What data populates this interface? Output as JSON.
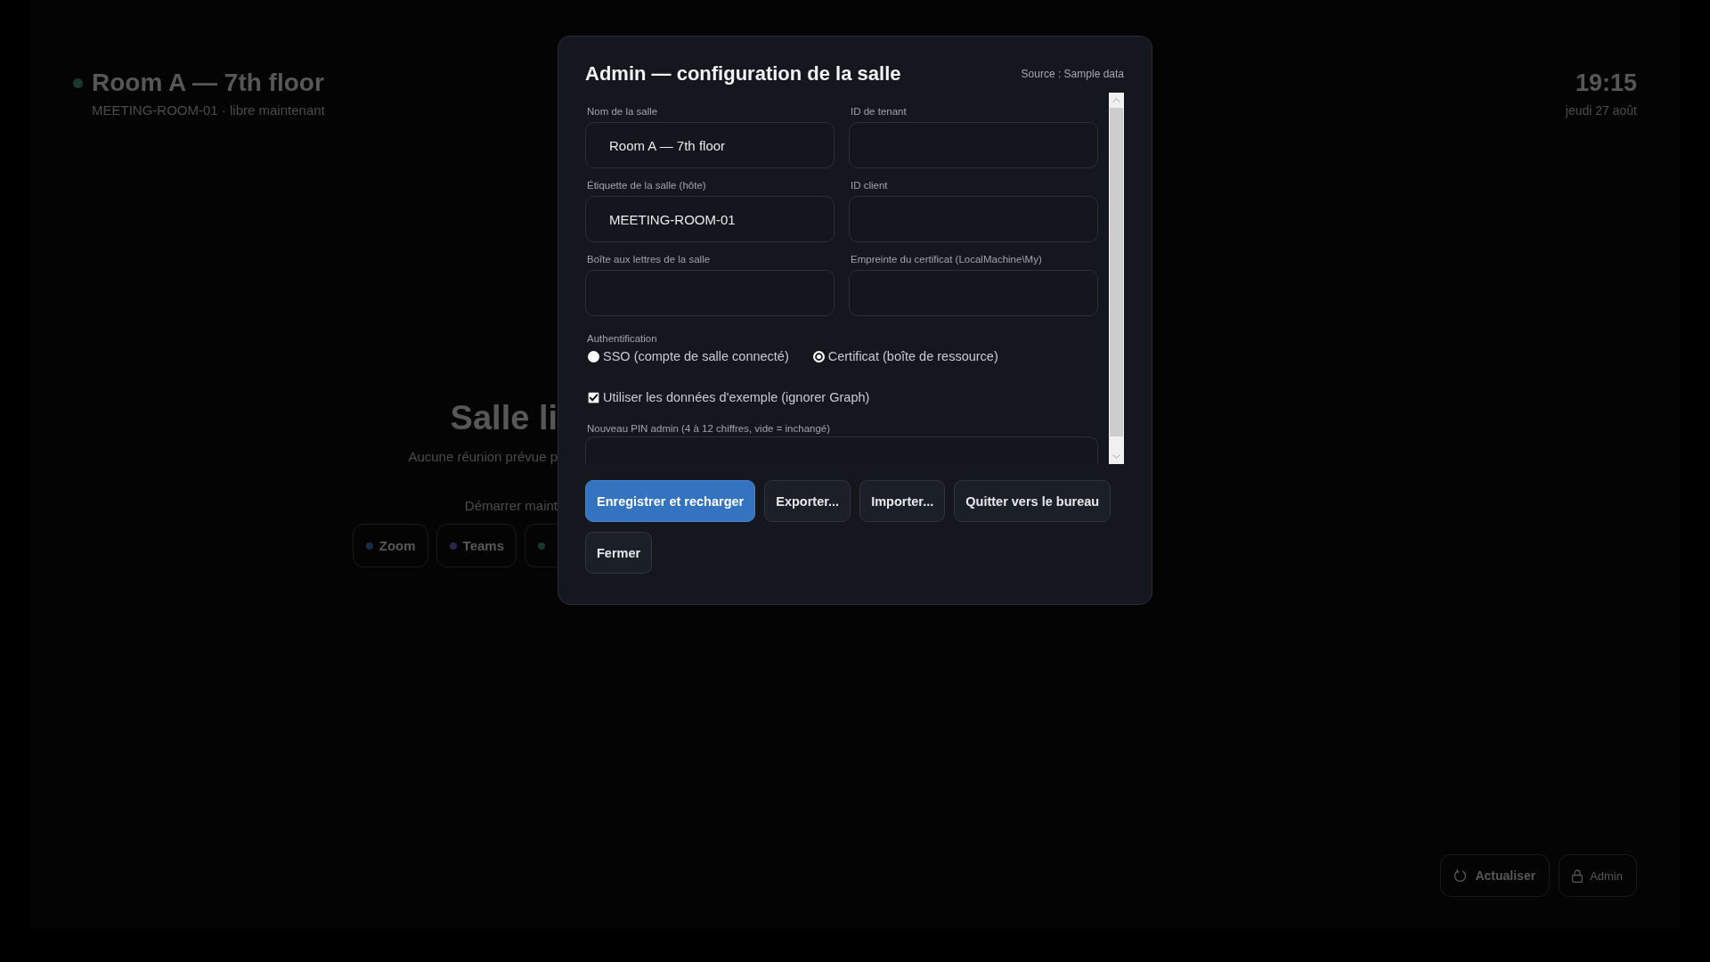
{
  "background": {
    "header": {
      "title": "Room A — 7th floor",
      "subtitle": "MEETING-ROOM-01 · libre maintenant",
      "time": "19:15",
      "date": "jeudi 27 août"
    },
    "status": {
      "heading": "Salle li",
      "message": "Aucune réunion prévue p",
      "start_label": "Démarrer maint",
      "platforms": [
        {
          "label": "Zoom",
          "color": "#1c2c48"
        },
        {
          "label": "Teams",
          "color": "#2a2450"
        },
        {
          "color": "#17382b"
        }
      ]
    },
    "footer_buttons": [
      {
        "kind": "refresh",
        "label": "Actualiser"
      },
      {
        "kind": "lock",
        "label": "Admin"
      }
    ]
  },
  "dialog": {
    "title": "Admin — configuration de la salle",
    "source": "Source : Sample data",
    "fields": [
      {
        "label": "Nom de la salle",
        "value": "Room A — 7th floor"
      },
      {
        "label": "ID de tenant"
      },
      {
        "label": "Étiquette de la salle (hôte)",
        "value": "MEETING-ROOM-01"
      },
      {
        "label": "ID client"
      },
      {
        "label": "Boîte aux lettres de la salle"
      },
      {
        "label": "Empreinte du certificat (LocalMachine\\My)"
      }
    ],
    "authentication": {
      "label": "Authentification",
      "options": [
        {
          "label": "SSO (compte de salle connecté)",
          "selected": false
        },
        {
          "label": "Certificat (boîte de ressource)",
          "selected": true
        }
      ]
    },
    "sample_data": {
      "label": "Utiliser les données d'exemple (ignorer Graph)",
      "checked": true
    },
    "pin": {
      "label": "Nouveau PIN admin (4 à 12 chiffres, vide = inchangé)"
    },
    "buttons": [
      {
        "kind": "primary",
        "label": "Enregistrer et recharger"
      },
      {
        "kind": "secondary",
        "label": "Exporter..."
      },
      {
        "kind": "secondary",
        "label": "Importer..."
      },
      {
        "kind": "secondary",
        "label": "Quitter vers le bureau"
      },
      {
        "kind": "secondary",
        "label": "Fermer"
      }
    ]
  }
}
